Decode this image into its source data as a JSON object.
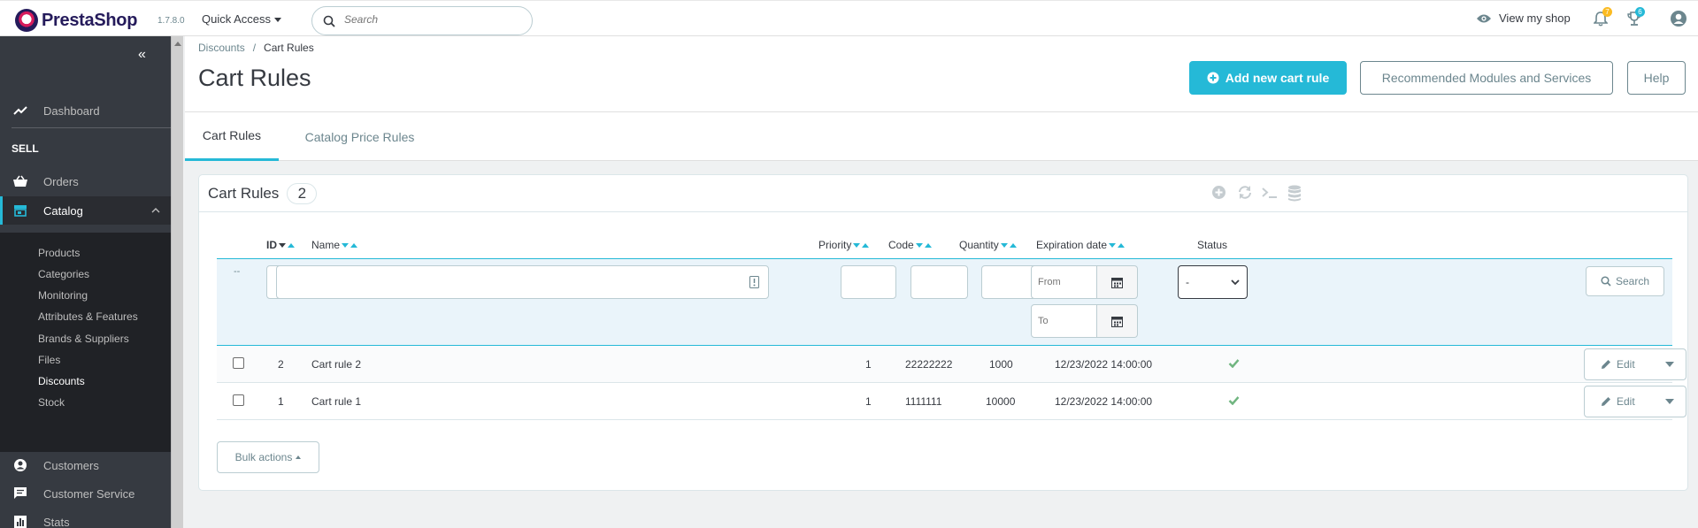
{
  "app": {
    "brand": "PrestaShop",
    "version": "1.7.8.0"
  },
  "header": {
    "quick_access": "Quick Access",
    "search_placeholder": "Search",
    "view_shop": "View my shop",
    "notif_count": "7",
    "orders_count": "6"
  },
  "sidebar": {
    "dashboard": "Dashboard",
    "section_sell": "SELL",
    "orders": "Orders",
    "catalog": "Catalog",
    "catalog_sub": [
      "Products",
      "Categories",
      "Monitoring",
      "Attributes & Features",
      "Brands & Suppliers",
      "Files",
      "Discounts",
      "Stock"
    ],
    "customers": "Customers",
    "customer_service": "Customer Service",
    "stats": "Stats"
  },
  "breadcrumb": {
    "parent": "Discounts",
    "current": "Cart Rules"
  },
  "page": {
    "title": "Cart Rules",
    "add_button": "Add new cart rule",
    "modules_button": "Recommended Modules and Services",
    "help_button": "Help"
  },
  "tabs": [
    "Cart Rules",
    "Catalog Price Rules"
  ],
  "panel": {
    "title": "Cart Rules",
    "count": "2",
    "columns": {
      "id": "ID",
      "name": "Name",
      "priority": "Priority",
      "code": "Code",
      "quantity": "Quantity",
      "expiration": "Expiration date",
      "status": "Status"
    },
    "filters": {
      "dash": "--",
      "from_placeholder": "From",
      "to_placeholder": "To",
      "status_value": "-",
      "search_button": "Search"
    },
    "rows": [
      {
        "id": "2",
        "name": "Cart rule 2",
        "priority": "1",
        "code": "22222222",
        "quantity": "1000",
        "expiration": "12/23/2022 14:00:00",
        "status": "enabled",
        "action": "Edit"
      },
      {
        "id": "1",
        "name": "Cart rule 1",
        "priority": "1",
        "code": "1111111",
        "quantity": "10000",
        "expiration": "12/23/2022 14:00:00",
        "status": "enabled",
        "action": "Edit"
      }
    ],
    "bulk_actions": "Bulk actions"
  },
  "colors": {
    "accent": "#25b9d7",
    "sidebar": "#363a41",
    "success": "#70b580",
    "notif_badge": "#fbbb22"
  }
}
